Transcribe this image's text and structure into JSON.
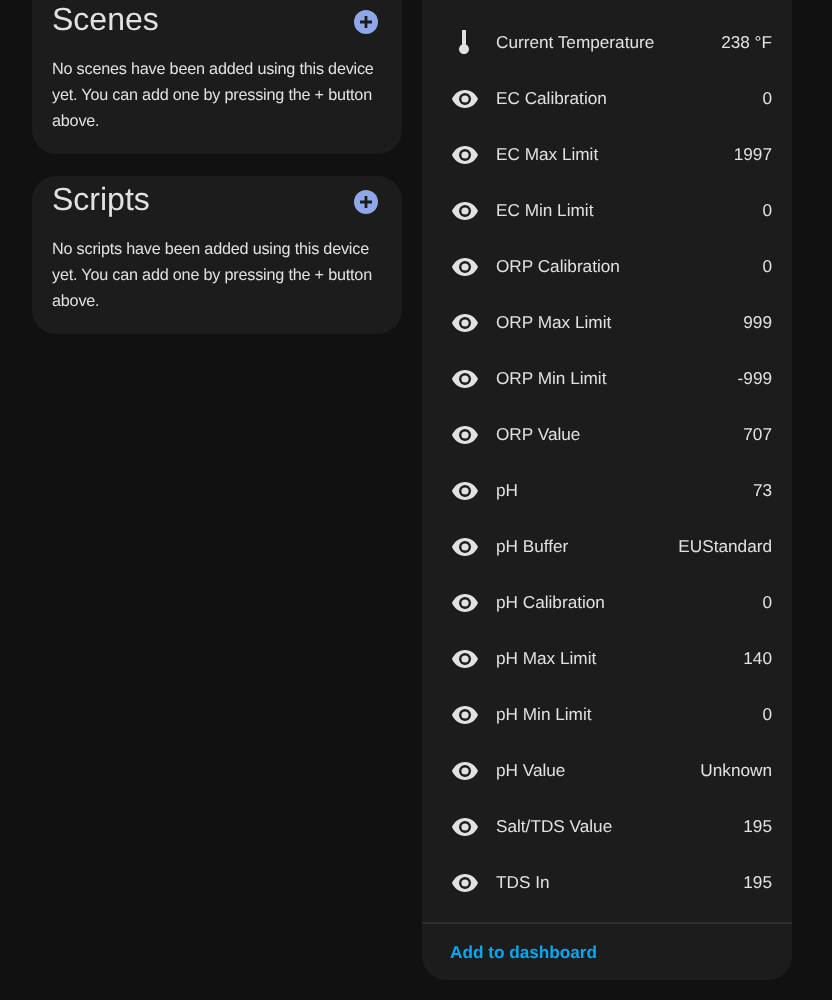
{
  "cards": [
    {
      "title": "Scenes",
      "message": "No scenes have been added using this device yet. You can add one by pressing the + button above."
    },
    {
      "title": "Scripts",
      "message": "No scripts have been added using this device yet. You can add one by pressing the + button above."
    }
  ],
  "entities": [
    {
      "kind": "temperature",
      "name": "Current Temperature",
      "value": "238 °F"
    },
    {
      "kind": "sensor",
      "name": "EC Calibration",
      "value": "0"
    },
    {
      "kind": "sensor",
      "name": "EC Max Limit",
      "value": "1997"
    },
    {
      "kind": "sensor",
      "name": "EC Min Limit",
      "value": "0"
    },
    {
      "kind": "sensor",
      "name": "ORP Calibration",
      "value": "0"
    },
    {
      "kind": "sensor",
      "name": "ORP Max Limit",
      "value": "999"
    },
    {
      "kind": "sensor",
      "name": "ORP Min Limit",
      "value": "-999"
    },
    {
      "kind": "sensor",
      "name": "ORP Value",
      "value": "707"
    },
    {
      "kind": "sensor",
      "name": "pH",
      "value": "73"
    },
    {
      "kind": "sensor",
      "name": "pH Buffer",
      "value": "EUStandard"
    },
    {
      "kind": "sensor",
      "name": "pH Calibration",
      "value": "0"
    },
    {
      "kind": "sensor",
      "name": "pH Max Limit",
      "value": "140"
    },
    {
      "kind": "sensor",
      "name": "pH Min Limit",
      "value": "0"
    },
    {
      "kind": "sensor",
      "name": "pH Value",
      "value": "Unknown"
    },
    {
      "kind": "sensor",
      "name": "Salt/TDS Value",
      "value": "195"
    },
    {
      "kind": "sensor",
      "name": "TDS In",
      "value": "195"
    }
  ],
  "footer_link": "Add to dashboard"
}
